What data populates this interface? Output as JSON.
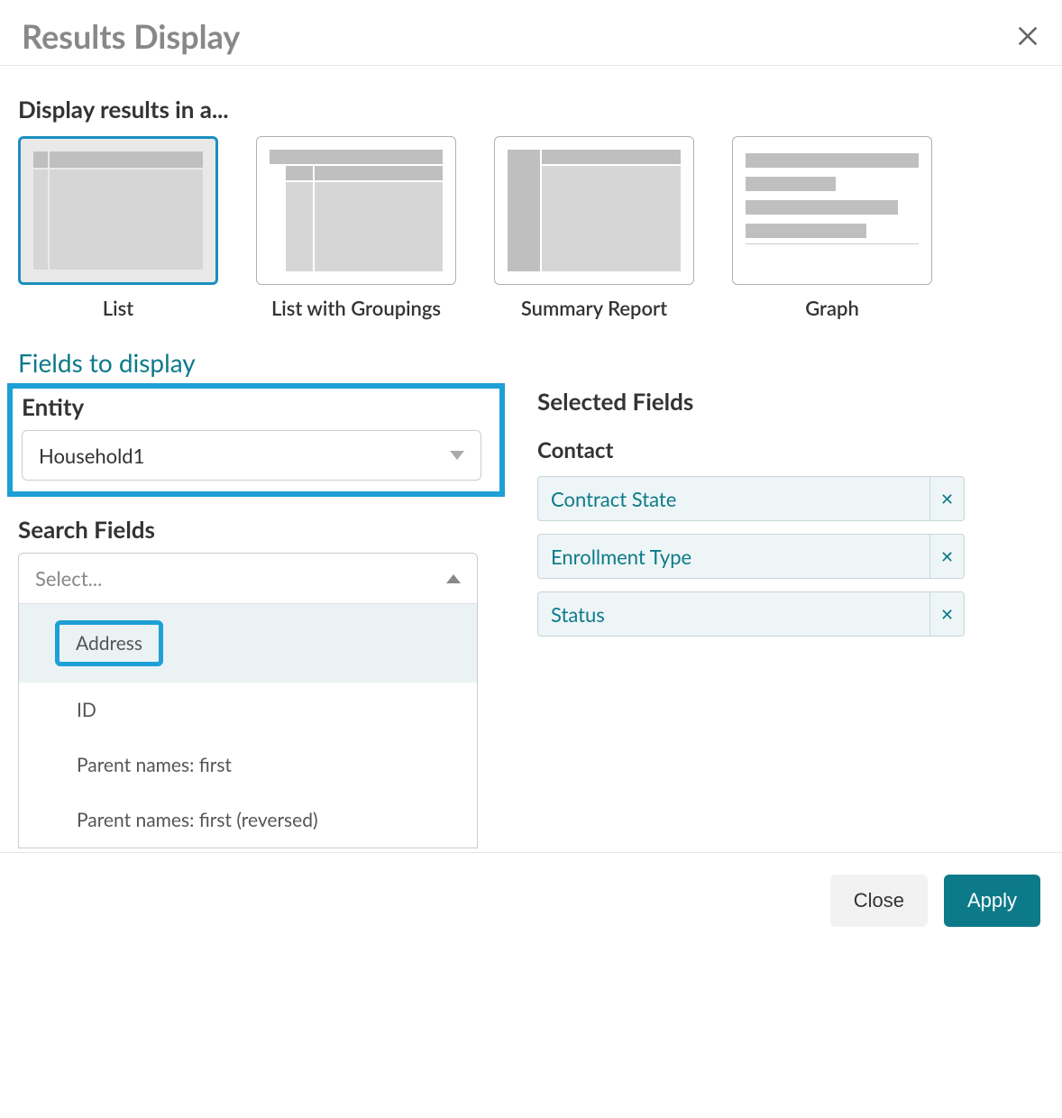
{
  "header": {
    "title": "Results Display"
  },
  "display_section": {
    "heading": "Display results in a...",
    "options": [
      {
        "label": "List"
      },
      {
        "label": "List with Groupings"
      },
      {
        "label": "Summary Report"
      },
      {
        "label": "Graph"
      }
    ]
  },
  "fields_heading": "Fields to display",
  "entity": {
    "label": "Entity",
    "value": "Household1"
  },
  "search_fields": {
    "label": "Search Fields",
    "placeholder": "Select...",
    "options": [
      "Address",
      "ID",
      "Parent names: first",
      "Parent names: first (reversed)"
    ]
  },
  "selected_fields": {
    "heading": "Selected Fields",
    "group": "Contact",
    "items": [
      "Contract State",
      "Enrollment Type",
      "Status"
    ]
  },
  "footer": {
    "close": "Close",
    "apply": "Apply"
  }
}
